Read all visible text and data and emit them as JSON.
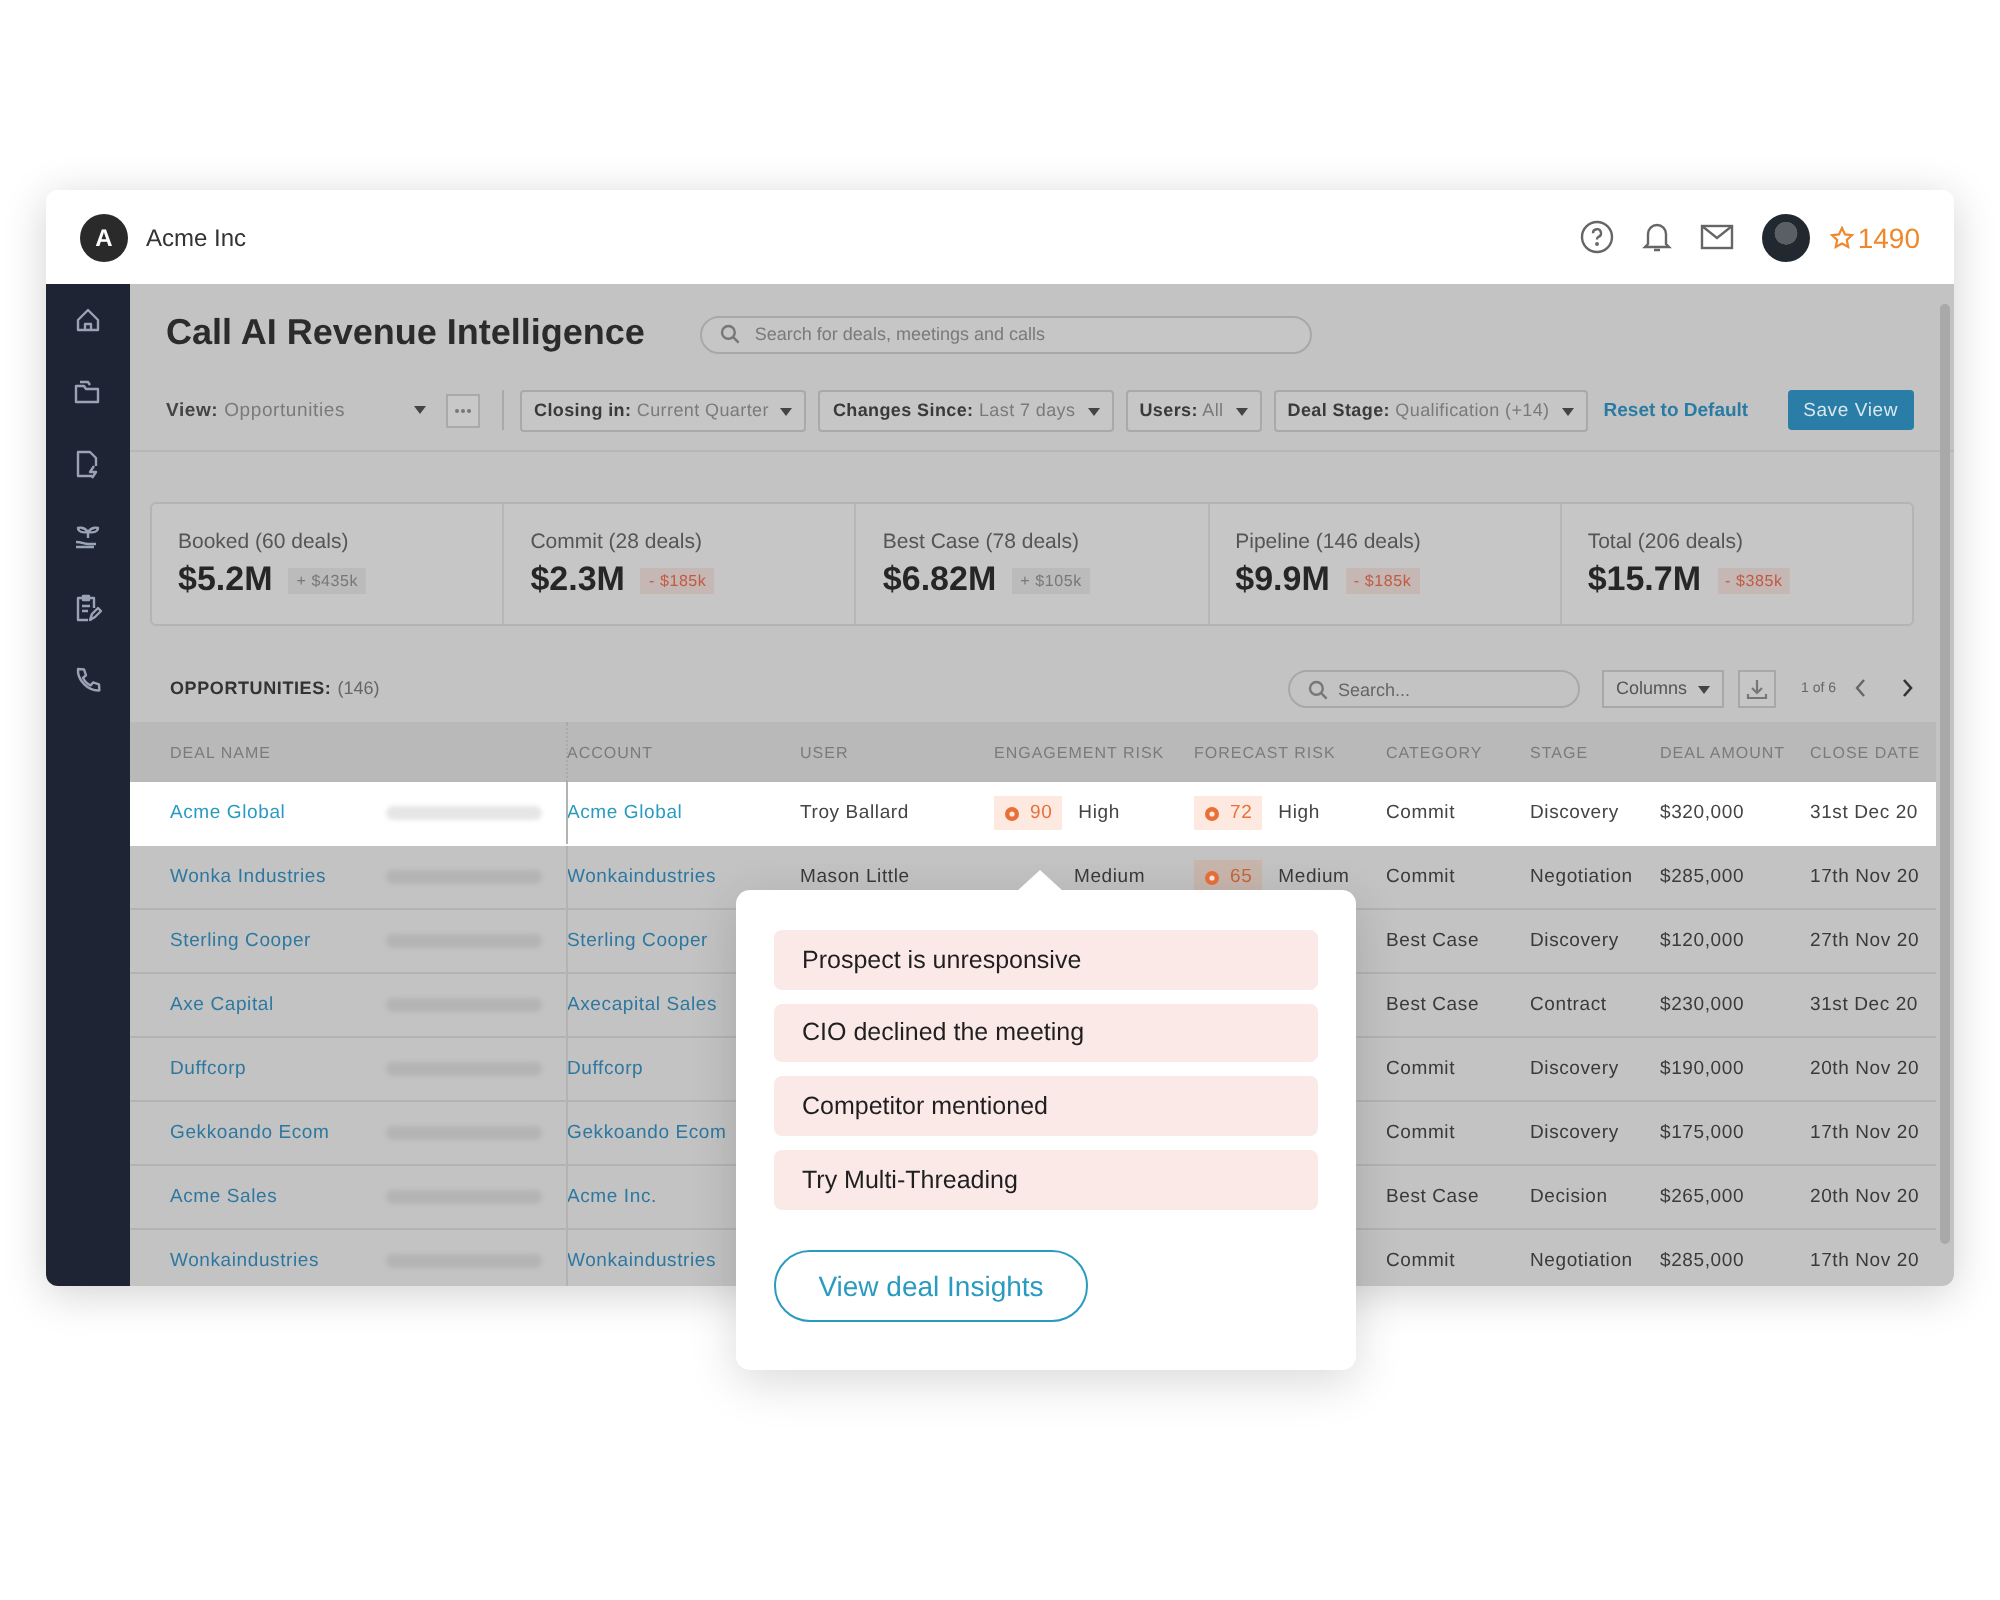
{
  "header": {
    "logo_letter": "A",
    "company": "Acme Inc",
    "points": "1490"
  },
  "sidebar": {
    "items": [
      {
        "kind": "home"
      },
      {
        "kind": "folder"
      },
      {
        "kind": "bolt-doc"
      },
      {
        "kind": "plant"
      },
      {
        "kind": "clipboard"
      },
      {
        "kind": "phone"
      }
    ]
  },
  "page": {
    "title": "Call AI Revenue Intelligence",
    "search": {
      "placeholder": "Search for deals, meetings and calls"
    }
  },
  "filters": {
    "view": {
      "label": "View:",
      "value": "Opportunities"
    },
    "chips": [
      {
        "label": "Closing in:",
        "value": "Current Quarter"
      },
      {
        "label": "Changes Since:",
        "value": "Last 7 days"
      },
      {
        "label": "Users:",
        "value": "All"
      },
      {
        "label": "Deal Stage:",
        "value": "Qualification (+14)"
      }
    ],
    "reset_link": "Reset to Default",
    "save_button": "Save View"
  },
  "summary": [
    {
      "label": "Booked (60 deals)",
      "amount": "$5.2M",
      "change": "+ $435k",
      "color": "#777777"
    },
    {
      "label": "Commit (28 deals)",
      "amount": "$2.3M",
      "change": "- $185k",
      "color": "#c25a40"
    },
    {
      "label": "Best Case (78 deals)",
      "amount": "$6.82M",
      "change": "+ $105k",
      "color": "#777777"
    },
    {
      "label": "Pipeline (146 deals)",
      "amount": "$9.9M",
      "change": "- $185k",
      "color": "#c25a40"
    },
    {
      "label": "Total (206 deals)",
      "amount": "$15.7M",
      "change": "- $385k",
      "color": "#c25a40"
    }
  ],
  "opportunities": {
    "title": "OPPORTUNITIES:",
    "count": "(146)",
    "search": {
      "placeholder": "Search..."
    },
    "columns_button": "Columns",
    "pager": "1 of 6"
  },
  "table": {
    "columns": [
      "DEAL NAME",
      "ACCOUNT",
      "USER",
      "ENGAGEMENT RISK",
      "FORECAST RISK",
      "CATEGORY",
      "STAGE",
      "DEAL AMOUNT",
      "CLOSE DATE"
    ],
    "rows": [
      {
        "selected": true,
        "deal": "Acme Global",
        "account": "Acme Global",
        "user": "Troy Ballard",
        "engagement": {
          "score": "90",
          "level": "High"
        },
        "forecast": {
          "score": "72",
          "level": "High"
        },
        "category": "Commit",
        "stage": "Discovery",
        "amount": "$320,000",
        "close_date": "31st Dec 20"
      },
      {
        "selected": false,
        "deal": "Wonka Industries",
        "account": "Wonkaindustries",
        "user": "Mason Little",
        "engagement": {
          "level": "Medium"
        },
        "forecast": {
          "score": "65",
          "level": "Medium"
        },
        "category": "Commit",
        "stage": "Negotiation",
        "amount": "$285,000",
        "close_date": "17th Nov 20"
      },
      {
        "selected": false,
        "deal": "Sterling Cooper",
        "account": "Sterling Cooper",
        "category": "Best Case",
        "stage": "Discovery",
        "amount": "$120,000",
        "close_date": "27th Nov 20"
      },
      {
        "selected": false,
        "deal": "Axe Capital",
        "account": "Axecapital Sales",
        "category": "Best Case",
        "stage": "Contract",
        "amount": "$230,000",
        "close_date": "31st Dec 20"
      },
      {
        "selected": false,
        "deal": "Duffcorp",
        "account": "Duffcorp",
        "category": "Commit",
        "stage": "Discovery",
        "amount": "$190,000",
        "close_date": "20th Nov 20"
      },
      {
        "selected": false,
        "deal": "Gekkoando Ecom",
        "account": "Gekkoando Ecom",
        "category": "Commit",
        "stage": "Discovery",
        "amount": "$175,000",
        "close_date": "17th Nov 20"
      },
      {
        "selected": false,
        "deal": "Acme Sales",
        "account": "Acme Inc.",
        "category": "Best Case",
        "stage": "Decision",
        "amount": "$265,000",
        "close_date": "20th Nov 20"
      },
      {
        "selected": false,
        "deal": "Wonkaindustries",
        "account": "Wonkaindustries",
        "category": "Commit",
        "stage": "Negotiation",
        "amount": "$285,000",
        "close_date": "17th Nov 20"
      }
    ]
  },
  "popover": {
    "items": [
      "Prospect is unresponsive",
      "CIO declined the meeting",
      "Competitor mentioned",
      "Try Multi-Threading"
    ],
    "button": "View deal Insights"
  }
}
